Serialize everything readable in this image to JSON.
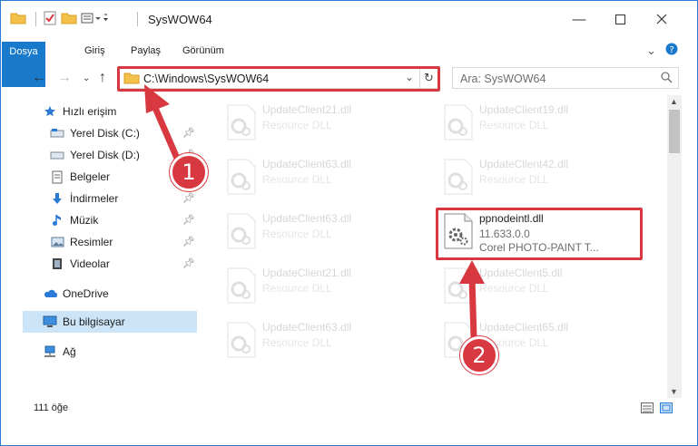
{
  "window": {
    "title": "SysWOW64",
    "accent": "#1979ca",
    "highlight_color": "#d8383f"
  },
  "ribbon": {
    "tabs": [
      "Dosya",
      "Giriş",
      "Paylaş",
      "Görünüm"
    ],
    "help_icon": "help-icon"
  },
  "address": {
    "path": "C:\\Windows\\SysWOW64",
    "search_placeholder": "Ara: SysWOW64"
  },
  "nav": {
    "quick_access": "Hızlı erişim",
    "items": [
      {
        "label": "Yerel Disk (C:)",
        "icon": "drive-icon",
        "pinned": true
      },
      {
        "label": "Yerel Disk (D:)",
        "icon": "drive-icon",
        "pinned": true
      },
      {
        "label": "Belgeler",
        "icon": "documents-icon",
        "pinned": true
      },
      {
        "label": "İndirmeler",
        "icon": "downloads-icon",
        "pinned": true
      },
      {
        "label": "Müzik",
        "icon": "music-icon",
        "pinned": true
      },
      {
        "label": "Resimler",
        "icon": "pictures-icon",
        "pinned": true
      },
      {
        "label": "Videolar",
        "icon": "videos-icon",
        "pinned": true
      }
    ],
    "onedrive": "OneDrive",
    "this_pc": "Bu bilgisayar",
    "network": "Ağ"
  },
  "files": {
    "left": [
      {
        "name": "UpdateClient21.dll",
        "type": "Resource DLL"
      },
      {
        "name": "UpdateClient63.dll",
        "type": "Resource DLL"
      },
      {
        "name": "UpdateClient63.dll",
        "type": "Resource DLL"
      },
      {
        "name": "UpdateClient21.dll",
        "type": "Resource DLL"
      },
      {
        "name": "UpdateClient63.dll",
        "type": "Resource DLL"
      }
    ],
    "right": [
      {
        "name": "UpdateClient19.dll",
        "type": "Resource DLL"
      },
      {
        "name": "UpdateClient42.dll",
        "type": "Resource DLL"
      },
      {
        "name": "UpdateClient5.dll",
        "type": "Resource DLL"
      },
      {
        "name": "UpdateClient65.dll",
        "type": "Resource DLL"
      }
    ],
    "highlighted": {
      "name": "ppnodeintl.dll",
      "version": "11.633.0.0",
      "description": "Corel PHOTO-PAINT T..."
    }
  },
  "status": {
    "count": "111 öğe"
  },
  "annotations": {
    "step1": "1",
    "step2": "2"
  }
}
